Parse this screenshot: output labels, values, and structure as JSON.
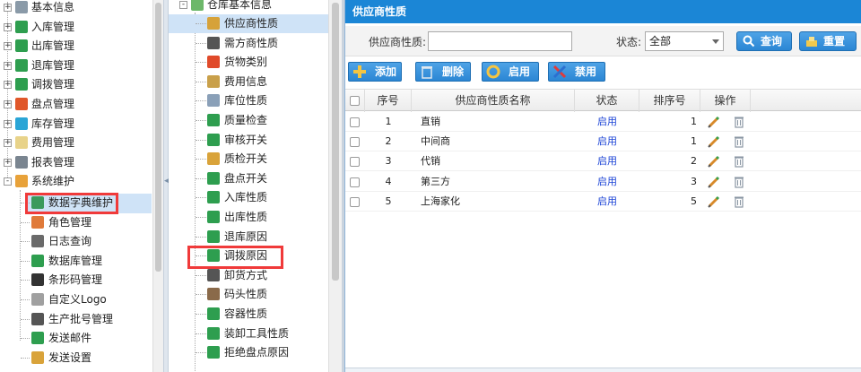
{
  "left_tree": {
    "items": [
      {
        "label": "基本信息",
        "expander": "+",
        "icon": "base-info-icon",
        "color": "#8a9aa8"
      },
      {
        "label": "入库管理",
        "expander": "+",
        "icon": "inbound-icon",
        "color": "#2e9e4f"
      },
      {
        "label": "出库管理",
        "expander": "+",
        "icon": "outbound-icon",
        "color": "#2e9e4f"
      },
      {
        "label": "退库管理",
        "expander": "+",
        "icon": "return-icon",
        "color": "#2e9e4f"
      },
      {
        "label": "调拨管理",
        "expander": "+",
        "icon": "transfer-icon",
        "color": "#2e9e4f"
      },
      {
        "label": "盘点管理",
        "expander": "+",
        "icon": "inventory-check-icon",
        "color": "#e0572a"
      },
      {
        "label": "库存管理",
        "expander": "+",
        "icon": "stock-icon",
        "color": "#2aa5d6"
      },
      {
        "label": "费用管理",
        "expander": "+",
        "icon": "expense-icon",
        "color": "#e8d38a"
      },
      {
        "label": "报表管理",
        "expander": "+",
        "icon": "report-icon",
        "color": "#7a8590"
      },
      {
        "label": "系统维护",
        "expander": "-",
        "icon": "system-icon",
        "color": "#e8a23a"
      }
    ],
    "children": [
      {
        "label": "数据字典维护",
        "icon": "dictionary-icon",
        "color": "#3a9a5c"
      },
      {
        "label": "角色管理",
        "icon": "role-icon",
        "color": "#e07a3a"
      },
      {
        "label": "日志查询",
        "icon": "log-icon",
        "color": "#6a6a6a"
      },
      {
        "label": "数据库管理",
        "icon": "database-icon",
        "color": "#2e9e4f"
      },
      {
        "label": "条形码管理",
        "icon": "barcode-icon",
        "color": "#333333"
      },
      {
        "label": "自定义Logo",
        "icon": "logo-icon",
        "color": "#a0a0a0"
      },
      {
        "label": "生产批号管理",
        "icon": "batch-icon",
        "color": "#555555"
      },
      {
        "label": "发送邮件",
        "icon": "mail-icon",
        "color": "#2e9e4f"
      },
      {
        "label": "发送设置",
        "icon": "send-settings-icon",
        "color": "#d9a33a"
      }
    ]
  },
  "mid_tree": {
    "root": {
      "label": "仓库基本信息",
      "icon": "warehouse-icon"
    },
    "items": [
      {
        "label": "供应商性质",
        "icon": "supplier-icon",
        "color": "#d6a23a"
      },
      {
        "label": "需方商性质",
        "icon": "demand-icon",
        "color": "#555555"
      },
      {
        "label": "货物类别",
        "icon": "goods-category-icon",
        "color": "#e04a2a"
      },
      {
        "label": "费用信息",
        "icon": "fee-info-icon",
        "color": "#c9a04a"
      },
      {
        "label": "库位性质",
        "icon": "location-icon",
        "color": "#8aa0b8"
      },
      {
        "label": "质量检查",
        "icon": "quality-icon",
        "color": "#2e9e4f"
      },
      {
        "label": "审核开关",
        "icon": "audit-switch-icon",
        "color": "#2e9e4f"
      },
      {
        "label": "质检开关",
        "icon": "qc-switch-icon",
        "color": "#d9a33a"
      },
      {
        "label": "盘点开关",
        "icon": "count-switch-icon",
        "color": "#2e9e4f"
      },
      {
        "label": "入库性质",
        "icon": "inbound-nature-icon",
        "color": "#2e9e4f"
      },
      {
        "label": "出库性质",
        "icon": "outbound-nature-icon",
        "color": "#2e9e4f"
      },
      {
        "label": "退库原因",
        "icon": "return-reason-icon",
        "color": "#2e9e4f"
      },
      {
        "label": "调拨原因",
        "icon": "transfer-reason-icon",
        "color": "#2e9e4f"
      },
      {
        "label": "卸货方式",
        "icon": "unload-icon",
        "color": "#555555"
      },
      {
        "label": "码头性质",
        "icon": "dock-icon",
        "color": "#8a6a4a"
      },
      {
        "label": "容器性质",
        "icon": "container-icon",
        "color": "#2e9e4f"
      },
      {
        "label": "装卸工具性质",
        "icon": "tool-icon",
        "color": "#2e9e4f"
      },
      {
        "label": "拒绝盘点原因",
        "icon": "reject-icon",
        "color": "#2e9e4f"
      }
    ]
  },
  "panel": {
    "title": "供应商性质",
    "search": {
      "name_label": "供应商性质:",
      "name_value": "",
      "status_label": "状态:",
      "status_value": "全部",
      "query_label": "查询",
      "reset_label": "重置"
    },
    "toolbar": {
      "add": "添加",
      "delete": "删除",
      "enable": "启用",
      "disable": "禁用"
    },
    "columns": [
      "序号",
      "供应商性质名称",
      "状态",
      "排序号",
      "操作"
    ],
    "rows": [
      {
        "no": "1",
        "name": "直销",
        "status": "启用",
        "order": "1"
      },
      {
        "no": "2",
        "name": "中间商",
        "status": "启用",
        "order": "1"
      },
      {
        "no": "3",
        "name": "代销",
        "status": "启用",
        "order": "2"
      },
      {
        "no": "4",
        "name": "第三方",
        "status": "启用",
        "order": "3"
      },
      {
        "no": "5",
        "name": "上海家化",
        "status": "启用",
        "order": "5"
      }
    ]
  },
  "colors": {
    "accent": "#1b86d6",
    "highlight": "#f03a3a",
    "selected": "#cfe3f7",
    "status_link": "#1b43d6"
  }
}
